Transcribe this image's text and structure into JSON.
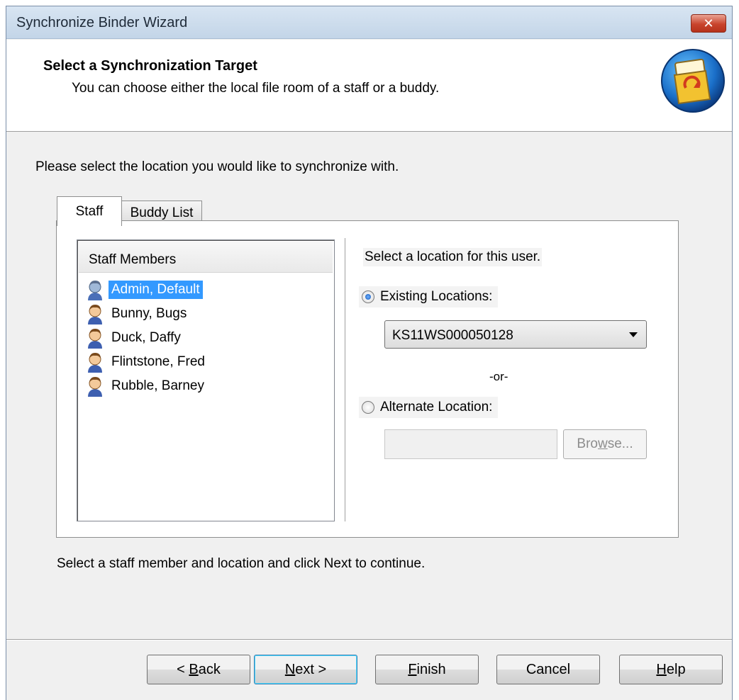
{
  "window": {
    "title": "Synchronize Binder Wizard",
    "close_label": "✕"
  },
  "header": {
    "title": "Select a Synchronization Target",
    "subtitle": "You can choose either the local file room of a staff or a buddy.",
    "icon": "binder-sync-icon"
  },
  "instruction": "Please select the location you would like to synchronize with.",
  "tabs": [
    {
      "label": "Staff",
      "active": true
    },
    {
      "label": "Buddy List",
      "active": false
    }
  ],
  "staff_list": {
    "header": "Staff Members",
    "items": [
      {
        "label": "Admin, Default",
        "selected": true
      },
      {
        "label": "Bunny, Bugs",
        "selected": false
      },
      {
        "label": "Duck, Daffy",
        "selected": false
      },
      {
        "label": "Flintstone, Fred",
        "selected": false
      },
      {
        "label": "Rubble, Barney",
        "selected": false
      }
    ]
  },
  "location": {
    "title": "Select a location for this user.",
    "existing_label": "Existing Locations:",
    "existing_value": "KS11WS000050128",
    "or_text": "-or-",
    "alternate_label": "Alternate Location:",
    "alternate_value": "",
    "browse_pre": "Bro",
    "browse_u": "w",
    "browse_post": "se..."
  },
  "footer_hint": "Select a staff member and location and click Next to continue.",
  "buttons": {
    "back_pre": "< ",
    "back_u": "B",
    "back_post": "ack",
    "next_u": "N",
    "next_post": "ext >",
    "finish_u": "F",
    "finish_post": "inish",
    "cancel": "Cancel",
    "help_u": "H",
    "help_post": "elp"
  },
  "colors": {
    "selection": "#3399ff",
    "title_bar": "#c3d5e8",
    "close_button": "#c9442d"
  }
}
